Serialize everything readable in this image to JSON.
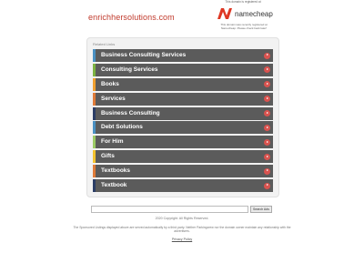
{
  "header": {
    "domain": "enrichhersolutions.com",
    "registered_caption": "This domain is registered at",
    "registrar_name": "namecheap",
    "registrar_note": "This domain was recently registered at Namecheap. Please check back later!"
  },
  "related_links": {
    "title": "Related Links",
    "items": [
      {
        "label": "Business Consulting Services",
        "bar_color": "#4a90c2"
      },
      {
        "label": "Consulting Services",
        "bar_color": "#7cb342"
      },
      {
        "label": "Books",
        "bar_color": "#f0a030"
      },
      {
        "label": "Services",
        "bar_color": "#e07b39"
      },
      {
        "label": "Business Consulting",
        "bar_color": "#2c3e66"
      },
      {
        "label": "Debt Solutions",
        "bar_color": "#4a90c2"
      },
      {
        "label": "For Him",
        "bar_color": "#9ccc65"
      },
      {
        "label": "Gifts",
        "bar_color": "#f4c430"
      },
      {
        "label": "Textbooks",
        "bar_color": "#e07b39"
      },
      {
        "label": "Textbook",
        "bar_color": "#2c3e66"
      }
    ]
  },
  "search": {
    "value": "",
    "button_label": "Search Ads"
  },
  "footer": {
    "copyright": "2020 Copyright. All Rights Reserved.",
    "disclaimer": "The Sponsored Listings displayed above are served automatically by a third party. Neither Parkingcrew nor the domain owner maintain any relationship with the advertisers.",
    "privacy_label": "Privacy Policy"
  },
  "colors": {
    "domain_text": "#c0392b",
    "link_row_bg": "#5b5b5b",
    "arrow_bg": "#d9534f",
    "namecheap_orange": "#de3723"
  }
}
